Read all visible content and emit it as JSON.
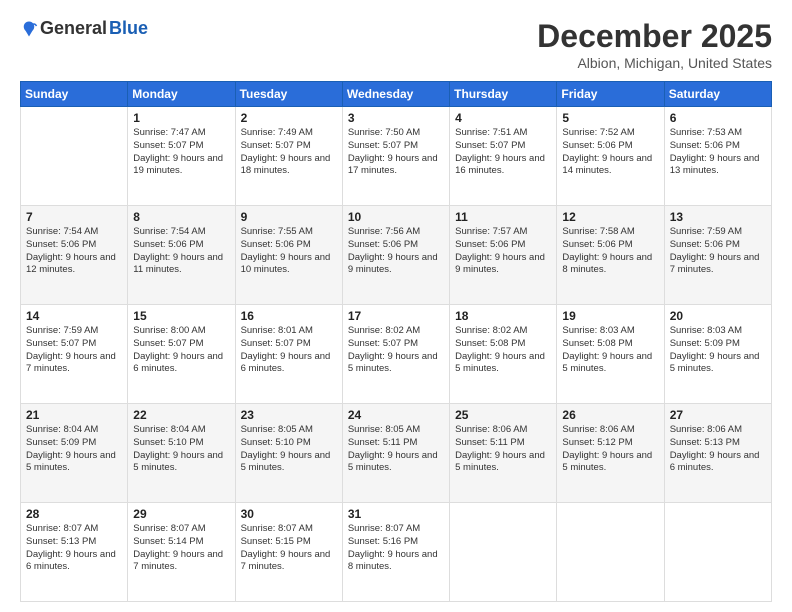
{
  "logo": {
    "general": "General",
    "blue": "Blue"
  },
  "header": {
    "month": "December 2025",
    "location": "Albion, Michigan, United States"
  },
  "weekdays": [
    "Sunday",
    "Monday",
    "Tuesday",
    "Wednesday",
    "Thursday",
    "Friday",
    "Saturday"
  ],
  "weeks": [
    [
      {
        "day": "",
        "sunrise": "",
        "sunset": "",
        "daylight": ""
      },
      {
        "day": "1",
        "sunrise": "Sunrise: 7:47 AM",
        "sunset": "Sunset: 5:07 PM",
        "daylight": "Daylight: 9 hours and 19 minutes."
      },
      {
        "day": "2",
        "sunrise": "Sunrise: 7:49 AM",
        "sunset": "Sunset: 5:07 PM",
        "daylight": "Daylight: 9 hours and 18 minutes."
      },
      {
        "day": "3",
        "sunrise": "Sunrise: 7:50 AM",
        "sunset": "Sunset: 5:07 PM",
        "daylight": "Daylight: 9 hours and 17 minutes."
      },
      {
        "day": "4",
        "sunrise": "Sunrise: 7:51 AM",
        "sunset": "Sunset: 5:07 PM",
        "daylight": "Daylight: 9 hours and 16 minutes."
      },
      {
        "day": "5",
        "sunrise": "Sunrise: 7:52 AM",
        "sunset": "Sunset: 5:06 PM",
        "daylight": "Daylight: 9 hours and 14 minutes."
      },
      {
        "day": "6",
        "sunrise": "Sunrise: 7:53 AM",
        "sunset": "Sunset: 5:06 PM",
        "daylight": "Daylight: 9 hours and 13 minutes."
      }
    ],
    [
      {
        "day": "7",
        "sunrise": "Sunrise: 7:54 AM",
        "sunset": "Sunset: 5:06 PM",
        "daylight": "Daylight: 9 hours and 12 minutes."
      },
      {
        "day": "8",
        "sunrise": "Sunrise: 7:54 AM",
        "sunset": "Sunset: 5:06 PM",
        "daylight": "Daylight: 9 hours and 11 minutes."
      },
      {
        "day": "9",
        "sunrise": "Sunrise: 7:55 AM",
        "sunset": "Sunset: 5:06 PM",
        "daylight": "Daylight: 9 hours and 10 minutes."
      },
      {
        "day": "10",
        "sunrise": "Sunrise: 7:56 AM",
        "sunset": "Sunset: 5:06 PM",
        "daylight": "Daylight: 9 hours and 9 minutes."
      },
      {
        "day": "11",
        "sunrise": "Sunrise: 7:57 AM",
        "sunset": "Sunset: 5:06 PM",
        "daylight": "Daylight: 9 hours and 9 minutes."
      },
      {
        "day": "12",
        "sunrise": "Sunrise: 7:58 AM",
        "sunset": "Sunset: 5:06 PM",
        "daylight": "Daylight: 9 hours and 8 minutes."
      },
      {
        "day": "13",
        "sunrise": "Sunrise: 7:59 AM",
        "sunset": "Sunset: 5:06 PM",
        "daylight": "Daylight: 9 hours and 7 minutes."
      }
    ],
    [
      {
        "day": "14",
        "sunrise": "Sunrise: 7:59 AM",
        "sunset": "Sunset: 5:07 PM",
        "daylight": "Daylight: 9 hours and 7 minutes."
      },
      {
        "day": "15",
        "sunrise": "Sunrise: 8:00 AM",
        "sunset": "Sunset: 5:07 PM",
        "daylight": "Daylight: 9 hours and 6 minutes."
      },
      {
        "day": "16",
        "sunrise": "Sunrise: 8:01 AM",
        "sunset": "Sunset: 5:07 PM",
        "daylight": "Daylight: 9 hours and 6 minutes."
      },
      {
        "day": "17",
        "sunrise": "Sunrise: 8:02 AM",
        "sunset": "Sunset: 5:07 PM",
        "daylight": "Daylight: 9 hours and 5 minutes."
      },
      {
        "day": "18",
        "sunrise": "Sunrise: 8:02 AM",
        "sunset": "Sunset: 5:08 PM",
        "daylight": "Daylight: 9 hours and 5 minutes."
      },
      {
        "day": "19",
        "sunrise": "Sunrise: 8:03 AM",
        "sunset": "Sunset: 5:08 PM",
        "daylight": "Daylight: 9 hours and 5 minutes."
      },
      {
        "day": "20",
        "sunrise": "Sunrise: 8:03 AM",
        "sunset": "Sunset: 5:09 PM",
        "daylight": "Daylight: 9 hours and 5 minutes."
      }
    ],
    [
      {
        "day": "21",
        "sunrise": "Sunrise: 8:04 AM",
        "sunset": "Sunset: 5:09 PM",
        "daylight": "Daylight: 9 hours and 5 minutes."
      },
      {
        "day": "22",
        "sunrise": "Sunrise: 8:04 AM",
        "sunset": "Sunset: 5:10 PM",
        "daylight": "Daylight: 9 hours and 5 minutes."
      },
      {
        "day": "23",
        "sunrise": "Sunrise: 8:05 AM",
        "sunset": "Sunset: 5:10 PM",
        "daylight": "Daylight: 9 hours and 5 minutes."
      },
      {
        "day": "24",
        "sunrise": "Sunrise: 8:05 AM",
        "sunset": "Sunset: 5:11 PM",
        "daylight": "Daylight: 9 hours and 5 minutes."
      },
      {
        "day": "25",
        "sunrise": "Sunrise: 8:06 AM",
        "sunset": "Sunset: 5:11 PM",
        "daylight": "Daylight: 9 hours and 5 minutes."
      },
      {
        "day": "26",
        "sunrise": "Sunrise: 8:06 AM",
        "sunset": "Sunset: 5:12 PM",
        "daylight": "Daylight: 9 hours and 5 minutes."
      },
      {
        "day": "27",
        "sunrise": "Sunrise: 8:06 AM",
        "sunset": "Sunset: 5:13 PM",
        "daylight": "Daylight: 9 hours and 6 minutes."
      }
    ],
    [
      {
        "day": "28",
        "sunrise": "Sunrise: 8:07 AM",
        "sunset": "Sunset: 5:13 PM",
        "daylight": "Daylight: 9 hours and 6 minutes."
      },
      {
        "day": "29",
        "sunrise": "Sunrise: 8:07 AM",
        "sunset": "Sunset: 5:14 PM",
        "daylight": "Daylight: 9 hours and 7 minutes."
      },
      {
        "day": "30",
        "sunrise": "Sunrise: 8:07 AM",
        "sunset": "Sunset: 5:15 PM",
        "daylight": "Daylight: 9 hours and 7 minutes."
      },
      {
        "day": "31",
        "sunrise": "Sunrise: 8:07 AM",
        "sunset": "Sunset: 5:16 PM",
        "daylight": "Daylight: 9 hours and 8 minutes."
      },
      {
        "day": "",
        "sunrise": "",
        "sunset": "",
        "daylight": ""
      },
      {
        "day": "",
        "sunrise": "",
        "sunset": "",
        "daylight": ""
      },
      {
        "day": "",
        "sunrise": "",
        "sunset": "",
        "daylight": ""
      }
    ]
  ]
}
